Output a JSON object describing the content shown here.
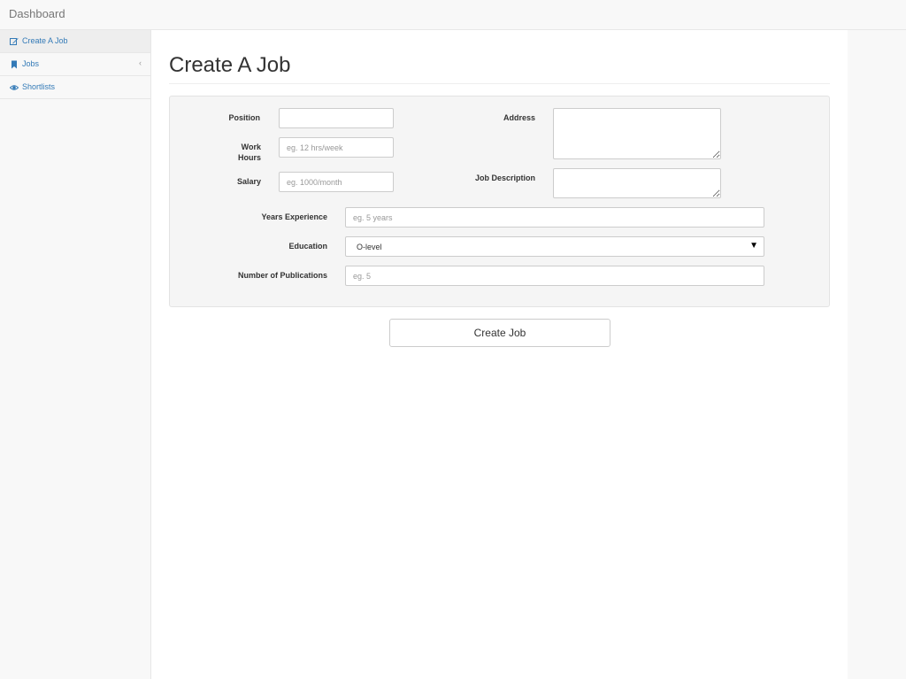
{
  "navbar": {
    "brand": "Dashboard"
  },
  "sidebar": {
    "items": [
      {
        "label": "Create A Job",
        "icon": "edit-icon",
        "active": true
      },
      {
        "label": "Jobs",
        "icon": "bookmark-icon",
        "expand_indicator": "‹"
      },
      {
        "label": "Shortlists",
        "icon": "eye-icon"
      }
    ]
  },
  "page": {
    "title": "Create A Job"
  },
  "form": {
    "position": {
      "label": "Position",
      "value": "",
      "placeholder": ""
    },
    "work_hours": {
      "label_line1": "Work",
      "label_line2": "Hours",
      "value": "",
      "placeholder": "eg. 12 hrs/week"
    },
    "salary": {
      "label": "Salary",
      "value": "",
      "placeholder": "eg. 1000/month"
    },
    "address": {
      "label": "Address",
      "value": "",
      "placeholder": ""
    },
    "job_description": {
      "label": "Job Description",
      "value": "",
      "placeholder": ""
    },
    "years_experience": {
      "label": "Years Experience",
      "value": "",
      "placeholder": "eg. 5 years"
    },
    "education": {
      "label": "Education",
      "selected": "O-level",
      "caret": "▼"
    },
    "publications": {
      "label": "Number of Publications",
      "value": "",
      "placeholder": "eg. 5"
    },
    "submit_label": "Create Job"
  },
  "colors": {
    "link": "#337ab7",
    "panel_bg": "#f5f5f5",
    "page_bg": "#f8f8f8"
  }
}
